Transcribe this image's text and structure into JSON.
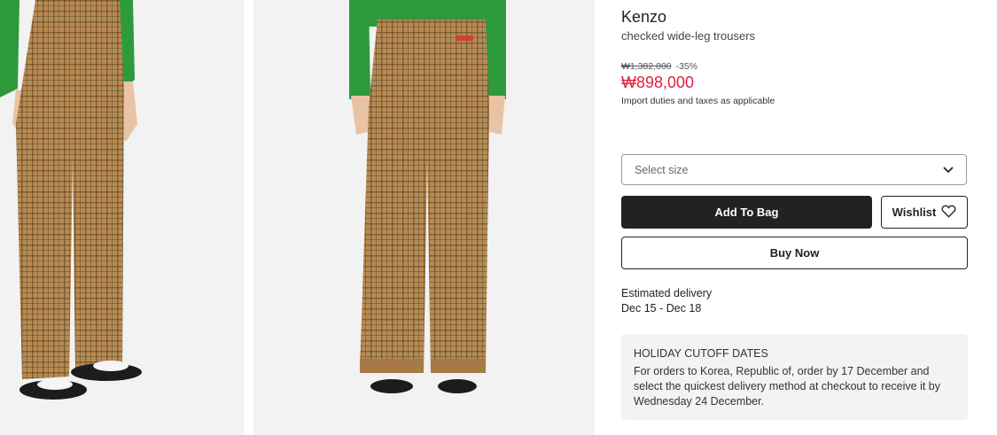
{
  "product": {
    "brand": "Kenzo",
    "name": "checked wide-leg trousers",
    "original_price": "₩1,382,000",
    "discount": "-35%",
    "sale_price": "₩898,000",
    "duties_note": "Import duties and taxes as applicable"
  },
  "size_select": {
    "placeholder": "Select size",
    "icon": "chevron-down-icon"
  },
  "actions": {
    "add_to_bag": "Add To Bag",
    "wishlist": "Wishlist",
    "wishlist_icon": "heart-icon",
    "buy_now": "Buy Now"
  },
  "delivery": {
    "label": "Estimated delivery",
    "dates": "Dec 15 - Dec 18"
  },
  "holiday_notice": {
    "title": "HOLIDAY CUTOFF DATES",
    "body": "For orders to Korea, Republic of, order by 17 December and select the quickest delivery method at checkout to receive it by Wednesday 24 December."
  },
  "colors": {
    "sale_red": "#e0203c",
    "button_dark": "#222222",
    "panel_bg": "#f3f3f3",
    "photo_bg": "#f2f2f2",
    "sweater_green": "#2e9a3c",
    "trouser_tan": "#b8874f"
  }
}
